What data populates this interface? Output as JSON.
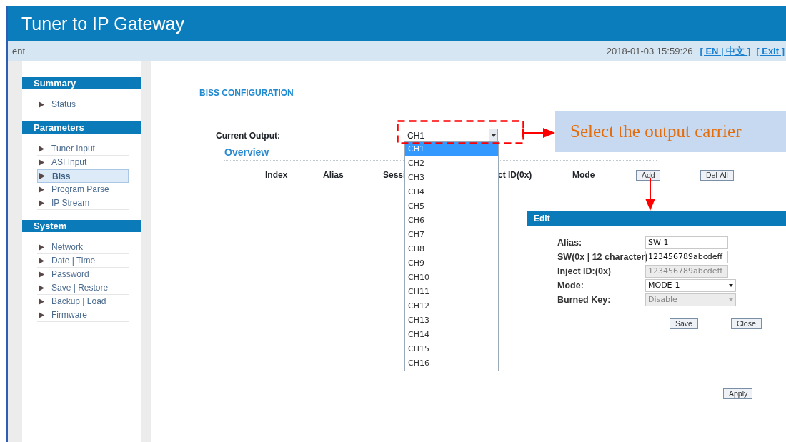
{
  "header": {
    "title": "Tuner to IP Gateway"
  },
  "top_bar": {
    "breadcrumb": "ent",
    "datetime": "2018-01-03 15:59:26",
    "language_switch": "[ EN | 中文 ]",
    "exit_link": "[ Exit ]"
  },
  "sidebar": {
    "groups": [
      {
        "title": "Summary",
        "items": [
          {
            "label": "Status",
            "selected": false
          }
        ]
      },
      {
        "title": "Parameters",
        "items": [
          {
            "label": "Tuner Input",
            "selected": false
          },
          {
            "label": "ASI Input",
            "selected": false
          },
          {
            "label": "Biss",
            "selected": true
          },
          {
            "label": "Program Parse",
            "selected": false
          },
          {
            "label": "IP Stream",
            "selected": false
          }
        ]
      },
      {
        "title": "System",
        "items": [
          {
            "label": "Network",
            "selected": false
          },
          {
            "label": "Date | Time",
            "selected": false
          },
          {
            "label": "Password",
            "selected": false
          },
          {
            "label": "Save | Restore",
            "selected": false
          },
          {
            "label": "Backup | Load",
            "selected": false
          },
          {
            "label": "Firmware",
            "selected": false
          }
        ]
      }
    ]
  },
  "main": {
    "title": "BISS CONFIGURATION",
    "current_output": {
      "label": "Current Output:",
      "value": "CH1",
      "expanded": true,
      "options": [
        {
          "label": "CH1",
          "selected": true
        },
        {
          "label": "CH2",
          "selected": false
        },
        {
          "label": "CH3",
          "selected": false
        },
        {
          "label": "CH4",
          "selected": false
        },
        {
          "label": "CH5",
          "selected": false
        },
        {
          "label": "CH6",
          "selected": false
        },
        {
          "label": "CH7",
          "selected": false
        },
        {
          "label": "CH8",
          "selected": false
        },
        {
          "label": "CH9",
          "selected": false
        },
        {
          "label": "CH10",
          "selected": false
        },
        {
          "label": "CH11",
          "selected": false
        },
        {
          "label": "CH12",
          "selected": false
        },
        {
          "label": "CH13",
          "selected": false
        },
        {
          "label": "CH14",
          "selected": false
        },
        {
          "label": "CH15",
          "selected": false
        },
        {
          "label": "CH16",
          "selected": false
        }
      ]
    },
    "overview": {
      "title": "Overview",
      "columns": [
        "Index",
        "Alias",
        "Sessi",
        "ct ID(0x)",
        "Mode"
      ],
      "buttons": [
        "Add",
        "Del-All"
      ]
    },
    "apply_button": "Apply"
  },
  "annotation": {
    "callout": "Select the output carrier"
  },
  "edit_dialog": {
    "title": "Edit",
    "fields": [
      {
        "kind": "text",
        "label": "Alias:",
        "value": "SW-1",
        "disabled": false
      },
      {
        "kind": "text",
        "label": "SW(0x | 12 character)",
        "value": "123456789abcdeff",
        "disabled": false
      },
      {
        "kind": "text",
        "label": "Inject ID:(0x)",
        "value": "123456789abcdeff",
        "disabled": true
      },
      {
        "kind": "select",
        "label": "Mode:",
        "value": "MODE-1",
        "disabled": false
      },
      {
        "kind": "select",
        "label": "Burned Key:",
        "value": "Disable",
        "disabled": true
      }
    ],
    "buttons": [
      "Save",
      "Close"
    ]
  }
}
